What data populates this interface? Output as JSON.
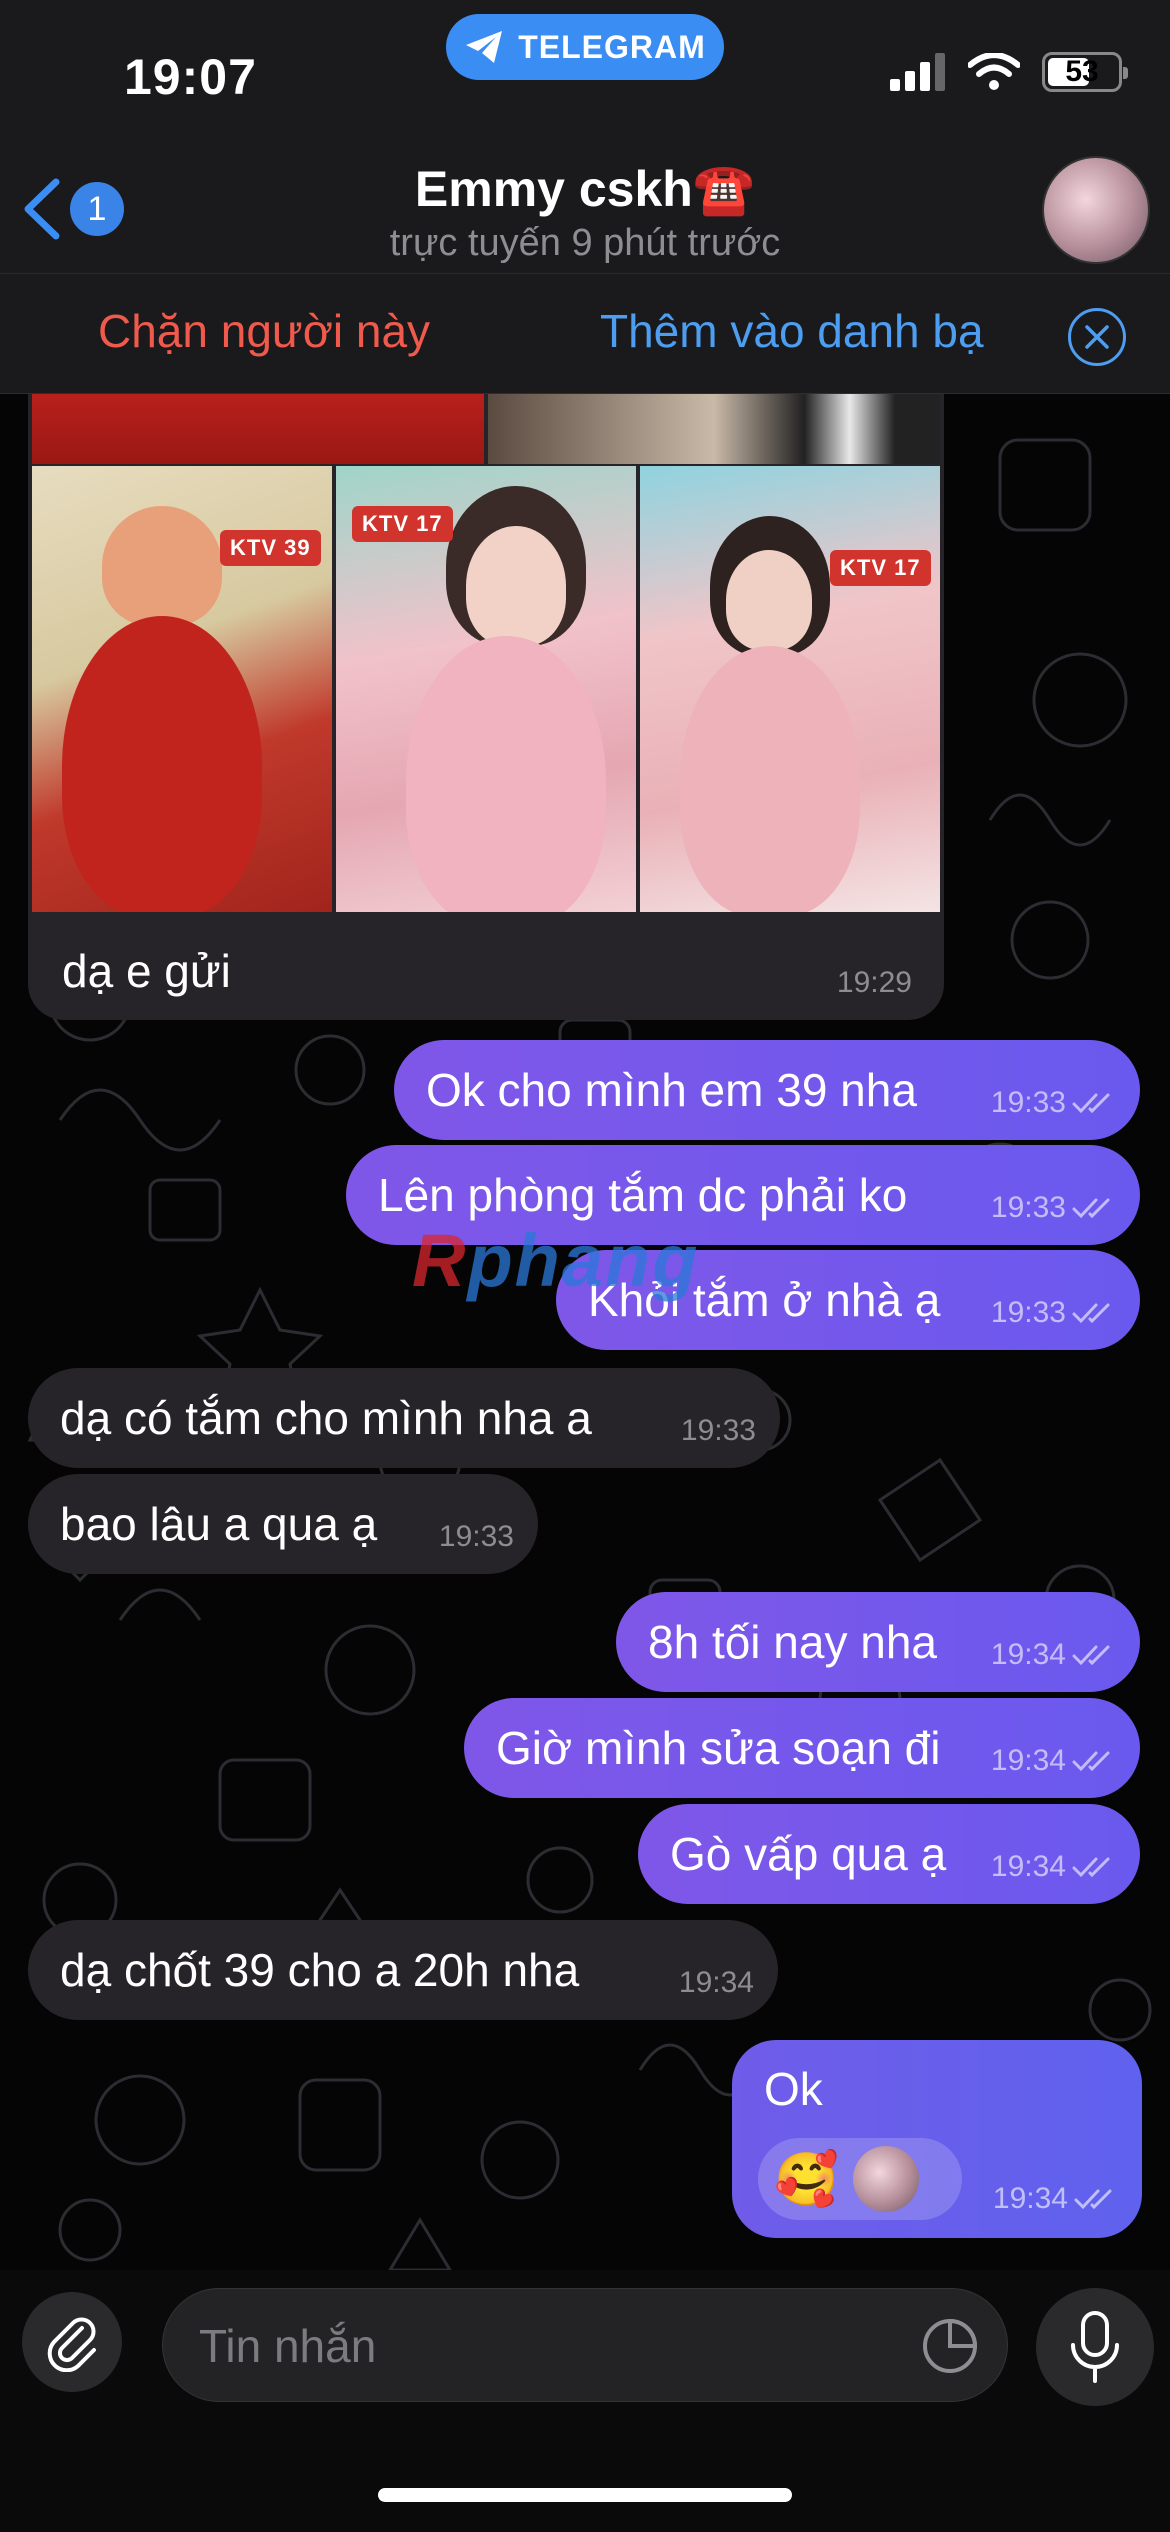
{
  "status_bar": {
    "time": "19:07",
    "app_pill": "TELEGRAM",
    "battery": "53"
  },
  "header": {
    "back_badge": "1",
    "title": "Emmy cskh☎️",
    "subtitle": "trực tuyến 9 phút trước"
  },
  "actions": {
    "block": "Chặn người này",
    "add_contact": "Thêm vào danh bạ"
  },
  "photo_message": {
    "tags": [
      "KTV 39",
      "KTV 17",
      "KTV 17"
    ],
    "caption": "dạ e gửi",
    "time": "19:29"
  },
  "messages": [
    {
      "dir": "out",
      "text": "Ok cho mình em 39 nha",
      "time": "19:33"
    },
    {
      "dir": "out",
      "text": "Lên phòng tắm dc phải ko",
      "time": "19:33"
    },
    {
      "dir": "out",
      "text": "Khỏi tắm ở nhà ạ",
      "time": "19:33"
    },
    {
      "dir": "in",
      "text": "dạ có tắm cho mình nha a",
      "time": "19:33"
    },
    {
      "dir": "in",
      "text": "bao lâu a qua ạ",
      "time": "19:33"
    },
    {
      "dir": "out",
      "text": "8h tối nay nha",
      "time": "19:34"
    },
    {
      "dir": "out",
      "text": "Giờ mình sửa soạn đi",
      "time": "19:34"
    },
    {
      "dir": "out",
      "text": "Gò vấp qua ạ",
      "time": "19:34"
    },
    {
      "dir": "in",
      "text": "dạ chốt 39 cho a 20h nha",
      "time": "19:34"
    }
  ],
  "last_message": {
    "text": "Ok",
    "reaction": "🥰",
    "time": "19:34"
  },
  "watermark": {
    "r": "R",
    "rest": "phang"
  },
  "input": {
    "placeholder": "Tin nhắn"
  },
  "colors": {
    "outgoing": "#7a58ea",
    "incoming": "#262429",
    "accent": "#3a8df2",
    "danger": "#ef5a4c"
  }
}
